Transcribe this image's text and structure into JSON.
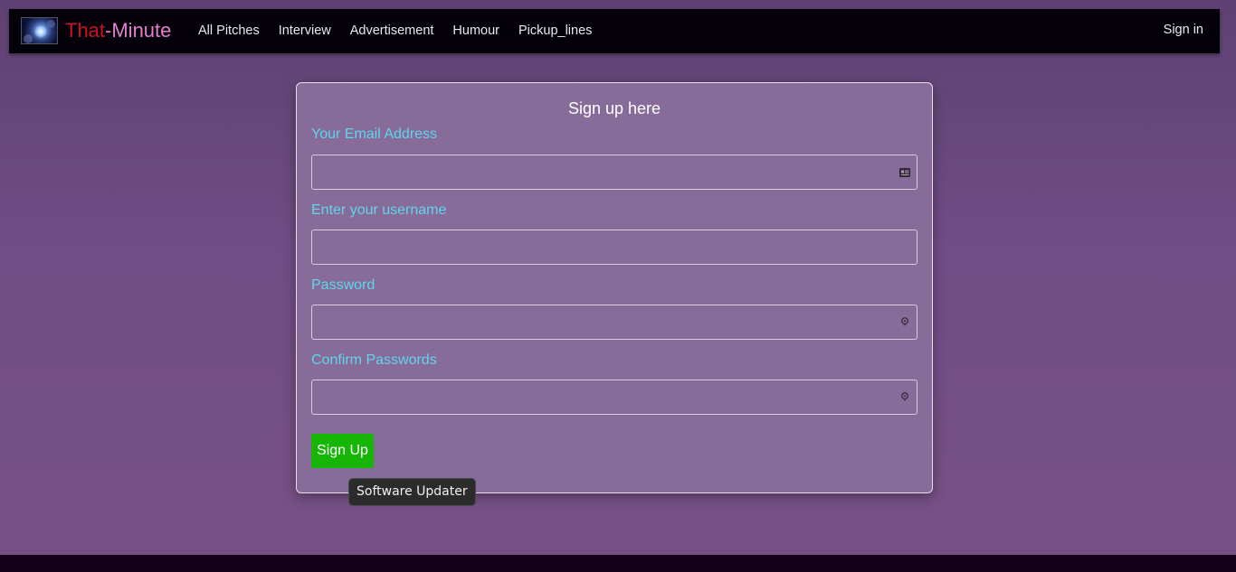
{
  "navbar": {
    "brand_part1": "That",
    "brand_dash": "-",
    "brand_part2": "Minute",
    "links": [
      "All Pitches",
      "Interview",
      "Advertisement",
      "Humour",
      "Pickup_lines"
    ],
    "signin_label": "Sign in"
  },
  "form": {
    "title": "Sign up here",
    "email_label": "Your Email Address",
    "email_value": "",
    "username_label": "Enter your username",
    "username_value": "",
    "password_label": "Password",
    "password_value": "",
    "confirm_label": "Confirm Passwords",
    "confirm_value": "",
    "submit_label": "Sign Up"
  },
  "tooltip": {
    "text": "Software Updater"
  },
  "icons": {
    "email_field_icon": "contact-card-icon",
    "password_field_icon": "key-icon",
    "confirm_field_icon": "key-icon"
  },
  "colors": {
    "navbar_bg": "#04000a",
    "page_bg": "#714d85",
    "card_bg": "#876b98",
    "label_color": "#5fd6ee",
    "button_bg": "#16b506",
    "brand_red": "#d10f26",
    "brand_pink": "#e47fcf"
  }
}
